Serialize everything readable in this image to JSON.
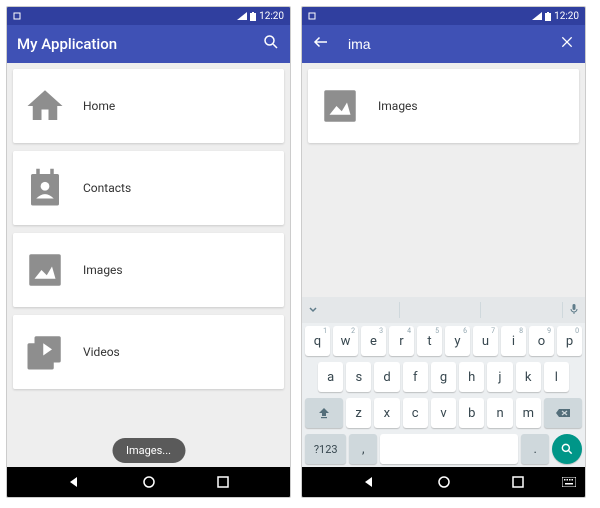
{
  "status": {
    "time": "12:20"
  },
  "left": {
    "title": "My Application",
    "items": [
      {
        "label": "Home"
      },
      {
        "label": "Contacts"
      },
      {
        "label": "Images"
      },
      {
        "label": "Videos"
      }
    ],
    "toast": "Images..."
  },
  "right": {
    "search_value": "ima",
    "result": {
      "label": "Images"
    }
  },
  "keyboard": {
    "row1": [
      "q",
      "w",
      "e",
      "r",
      "t",
      "y",
      "u",
      "i",
      "o",
      "p"
    ],
    "nums": [
      "1",
      "2",
      "3",
      "4",
      "5",
      "6",
      "7",
      "8",
      "9",
      "0"
    ],
    "row2": [
      "a",
      "s",
      "d",
      "f",
      "g",
      "h",
      "j",
      "k",
      "l"
    ],
    "row3": [
      "z",
      "x",
      "c",
      "v",
      "b",
      "n",
      "m"
    ],
    "sym": "?123",
    "comma": ",",
    "period": "."
  }
}
